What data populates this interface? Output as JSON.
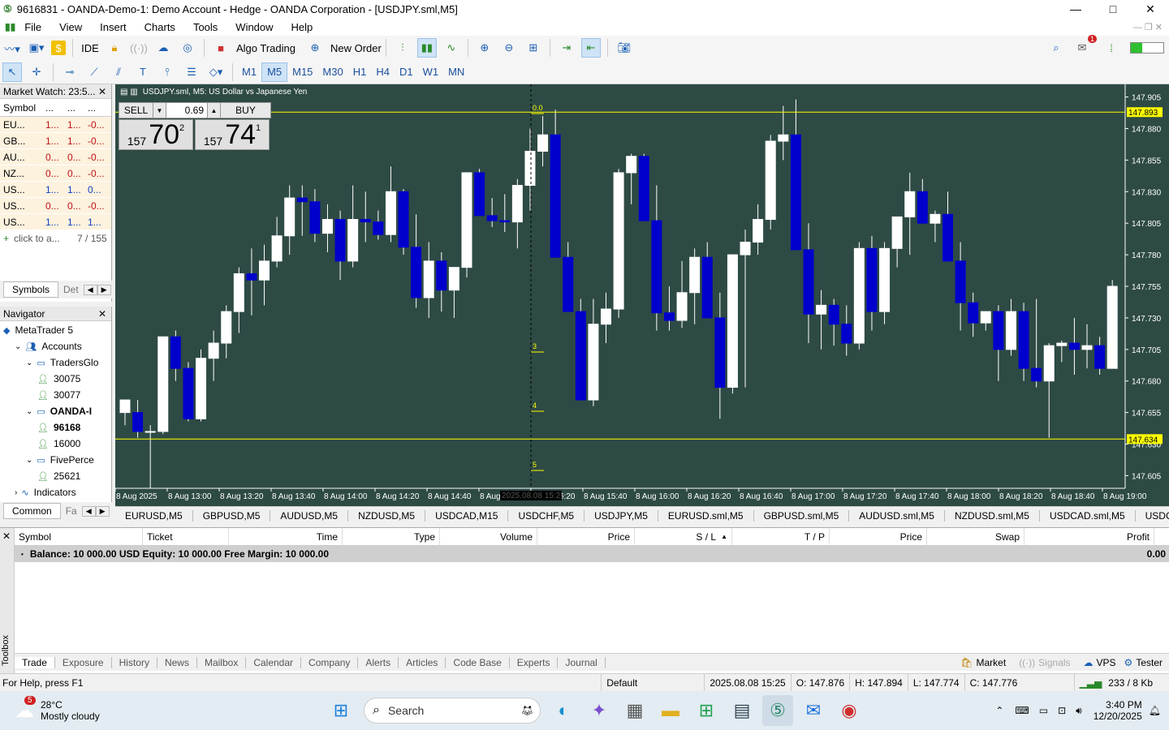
{
  "window": {
    "title": "9616831 - OANDA-Demo-1: Demo Account - Hedge - OANDA Corporation - [USDJPY.sml,M5]",
    "minimize": "—",
    "maximize": "□",
    "close": "✕"
  },
  "menu": [
    "File",
    "View",
    "Insert",
    "Charts",
    "Tools",
    "Window",
    "Help"
  ],
  "toolbar": {
    "ide": "IDE",
    "algo_trading": "Algo Trading",
    "new_order": "New Order",
    "notifications_badge": "1"
  },
  "timeframes": [
    "M1",
    "M5",
    "M15",
    "M30",
    "H1",
    "H4",
    "D1",
    "W1",
    "MN"
  ],
  "active_timeframe": "M5",
  "market_watch": {
    "title": "Market Watch: 23:5...",
    "columns": [
      "Symbol",
      "...",
      "...",
      "..."
    ],
    "rows": [
      {
        "symbol": "EU...",
        "bid": "1...",
        "ask": "1...",
        "chg": "-0...",
        "neg": true
      },
      {
        "symbol": "GB...",
        "bid": "1...",
        "ask": "1...",
        "chg": "-0...",
        "neg": true
      },
      {
        "symbol": "AU...",
        "bid": "0...",
        "ask": "0...",
        "chg": "-0...",
        "neg": true
      },
      {
        "symbol": "NZ...",
        "bid": "0...",
        "ask": "0...",
        "chg": "-0...",
        "neg": true
      },
      {
        "symbol": "US...",
        "bid": "1...",
        "ask": "1...",
        "chg": "0...",
        "neg": false
      },
      {
        "symbol": "US...",
        "bid": "0...",
        "ask": "0...",
        "chg": "-0...",
        "neg": true
      },
      {
        "symbol": "US...",
        "bid": "1...",
        "ask": "1...",
        "chg": "1...",
        "neg": false
      }
    ],
    "add_row": "click to a...",
    "count": "7 / 155",
    "tabs": [
      "Symbols",
      "Det"
    ]
  },
  "navigator": {
    "title": "Navigator",
    "items": [
      {
        "label": "MetaTrader 5",
        "level": 0,
        "bold": false
      },
      {
        "label": "Accounts",
        "level": 1,
        "bold": false
      },
      {
        "label": "TradersGlo",
        "level": 2,
        "bold": false
      },
      {
        "label": "30075",
        "level": 3,
        "bold": false
      },
      {
        "label": "30077",
        "level": 3,
        "bold": false
      },
      {
        "label": "OANDA-I",
        "level": 2,
        "bold": true
      },
      {
        "label": "96168",
        "level": 3,
        "bold": true
      },
      {
        "label": "16000",
        "level": 3,
        "bold": false
      },
      {
        "label": "FivePerce",
        "level": 2,
        "bold": false
      },
      {
        "label": "25621",
        "level": 3,
        "bold": false
      },
      {
        "label": "Indicators",
        "level": 1,
        "bold": false
      }
    ],
    "tabs": [
      "Common",
      "Fa"
    ]
  },
  "chart": {
    "header": "USDJPY.sml, M5:  US Dollar vs Japanese Yen",
    "sell_label": "SELL",
    "buy_label": "BUY",
    "volume": "0.69",
    "sell_price_small": "157",
    "sell_price_big": "70",
    "sell_price_sup": "2",
    "buy_price_small": "157",
    "buy_price_big": "74",
    "buy_price_sup": "1",
    "upper_line_label": "147.893",
    "lower_line_label": "147.634",
    "fib_labels": [
      "0.0",
      "3",
      "4",
      "5"
    ],
    "crosshair_time": "2025.08.08 15:25",
    "colors": {
      "background": "#2e4a45",
      "bull": "#ffffff",
      "bear": "#0000cc",
      "line": "#ffff00"
    }
  },
  "chart_data": {
    "type": "candlestick",
    "symbol": "USDJPY.sml",
    "timeframe": "M5",
    "y_ticks": [
      "147.905",
      "147.880",
      "147.855",
      "147.830",
      "147.805",
      "147.780",
      "147.755",
      "147.730",
      "147.705",
      "147.680",
      "147.655",
      "147.630",
      "147.605"
    ],
    "x_ticks": [
      "8 Aug 2025",
      "8 Aug 13:00",
      "8 Aug 13:20",
      "8 Aug 13:40",
      "8 Aug 14:00",
      "8 Aug 14:20",
      "8 Aug 14:40",
      "8 Aug 15:00",
      "8 Aug 15:20",
      "8 Aug 15:40",
      "8 Aug 16:00",
      "8 Aug 16:20",
      "8 Aug 16:40",
      "8 Aug 17:00",
      "8 Aug 17:20",
      "8 Aug 17:40",
      "8 Aug 18:00",
      "8 Aug 18:20",
      "8 Aug 18:40",
      "8 Aug 19:00"
    ],
    "ylim": [
      147.595,
      147.915
    ],
    "ohlc": [
      [
        147.655,
        147.665,
        147.645,
        147.665
      ],
      [
        147.655,
        147.665,
        147.635,
        147.64
      ],
      [
        147.64,
        147.645,
        147.595,
        147.64
      ],
      [
        147.64,
        147.715,
        147.638,
        147.715
      ],
      [
        147.715,
        147.72,
        147.68,
        147.69
      ],
      [
        147.69,
        147.695,
        147.648,
        147.65
      ],
      [
        147.65,
        147.705,
        147.648,
        147.698
      ],
      [
        147.698,
        147.72,
        147.68,
        147.71
      ],
      [
        147.71,
        147.74,
        147.698,
        147.735
      ],
      [
        147.735,
        147.77,
        147.718,
        147.765
      ],
      [
        147.765,
        147.785,
        147.732,
        147.76
      ],
      [
        147.76,
        147.788,
        147.74,
        147.775
      ],
      [
        147.775,
        147.81,
        147.77,
        147.795
      ],
      [
        147.795,
        147.835,
        147.78,
        147.825
      ],
      [
        147.825,
        147.835,
        147.795,
        147.822
      ],
      [
        147.822,
        147.832,
        147.79,
        147.797
      ],
      [
        147.797,
        147.82,
        147.782,
        147.808
      ],
      [
        147.808,
        147.815,
        147.76,
        147.775
      ],
      [
        147.775,
        147.835,
        147.77,
        147.808
      ],
      [
        147.808,
        147.83,
        147.79,
        147.806
      ],
      [
        147.806,
        147.815,
        147.792,
        147.796
      ],
      [
        147.796,
        147.85,
        147.79,
        147.83
      ],
      [
        147.83,
        147.832,
        147.78,
        147.786
      ],
      [
        147.786,
        147.812,
        147.738,
        147.746
      ],
      [
        147.746,
        147.79,
        147.73,
        147.775
      ],
      [
        147.775,
        147.782,
        147.735,
        147.752
      ],
      [
        147.752,
        147.768,
        147.73,
        147.77
      ],
      [
        147.77,
        147.845,
        147.762,
        147.845
      ],
      [
        147.845,
        147.848,
        147.815,
        147.811
      ],
      [
        147.811,
        147.825,
        147.802,
        147.807
      ],
      [
        147.807,
        147.828,
        147.798,
        147.806
      ],
      [
        147.806,
        147.84,
        147.785,
        147.835
      ],
      [
        147.835,
        147.88,
        147.815,
        147.862
      ],
      [
        147.862,
        147.89,
        147.85,
        147.875
      ],
      [
        147.875,
        147.895,
        147.8,
        147.778
      ],
      [
        147.778,
        147.79,
        147.745,
        147.735
      ],
      [
        147.735,
        147.745,
        147.67,
        147.665
      ],
      [
        147.665,
        147.745,
        147.66,
        147.725
      ],
      [
        147.725,
        147.75,
        147.71,
        147.737
      ],
      [
        147.737,
        147.848,
        147.73,
        147.845
      ],
      [
        147.845,
        147.86,
        147.82,
        147.858
      ],
      [
        147.858,
        147.86,
        147.81,
        147.807
      ],
      [
        147.807,
        147.835,
        147.72,
        147.734
      ],
      [
        147.734,
        147.755,
        147.72,
        147.728
      ],
      [
        147.728,
        147.775,
        147.722,
        147.75
      ],
      [
        147.75,
        147.785,
        147.725,
        147.778
      ],
      [
        147.778,
        147.79,
        147.74,
        147.73
      ],
      [
        147.73,
        147.75,
        147.65,
        147.675
      ],
      [
        147.675,
        147.78,
        147.67,
        147.78
      ],
      [
        147.78,
        147.8,
        147.675,
        147.79
      ],
      [
        147.79,
        147.82,
        147.78,
        147.808
      ],
      [
        147.808,
        147.875,
        147.8,
        147.87
      ],
      [
        147.87,
        147.898,
        147.855,
        147.875
      ],
      [
        147.875,
        147.903,
        147.79,
        147.784
      ],
      [
        147.784,
        147.805,
        147.71,
        147.733
      ],
      [
        147.733,
        147.752,
        147.705,
        147.74
      ],
      [
        147.74,
        147.745,
        147.708,
        147.725
      ],
      [
        147.725,
        147.74,
        147.7,
        147.71
      ],
      [
        147.71,
        147.79,
        147.705,
        147.785
      ],
      [
        147.785,
        147.795,
        147.72,
        147.735
      ],
      [
        147.735,
        147.79,
        147.725,
        147.785
      ],
      [
        147.785,
        147.81,
        147.77,
        147.81
      ],
      [
        147.81,
        147.845,
        147.78,
        147.83
      ],
      [
        147.83,
        147.84,
        147.805,
        147.805
      ],
      [
        147.805,
        147.815,
        147.79,
        147.812
      ],
      [
        147.812,
        147.83,
        147.775,
        147.775
      ],
      [
        147.775,
        147.79,
        147.72,
        147.742
      ],
      [
        147.742,
        147.75,
        147.715,
        147.726
      ],
      [
        147.726,
        147.73,
        147.72,
        147.735
      ],
      [
        147.735,
        147.74,
        147.68,
        147.705
      ],
      [
        147.705,
        147.745,
        147.7,
        147.735
      ],
      [
        147.735,
        147.742,
        147.68,
        147.69
      ],
      [
        147.69,
        147.745,
        147.675,
        147.68
      ],
      [
        147.68,
        147.71,
        147.635,
        147.708
      ],
      [
        147.708,
        147.712,
        147.695,
        147.71
      ],
      [
        147.71,
        147.73,
        147.685,
        147.705
      ],
      [
        147.705,
        147.725,
        147.69,
        147.708
      ],
      [
        147.708,
        147.715,
        147.685,
        147.69
      ],
      [
        147.69,
        147.76,
        147.69,
        147.755
      ]
    ]
  },
  "chart_tabs": [
    "EURUSD,M5",
    "GBPUSD,M5",
    "AUDUSD,M5",
    "NZDUSD,M5",
    "USDCAD,M15",
    "USDCHF,M5",
    "USDJPY,M5",
    "EURUSD.sml,M5",
    "GBPUSD.sml,M5",
    "AUDUSD.sml,M5",
    "NZDUSD.sml,M5",
    "USDCAD.sml,M5",
    "USDCHF.sml,M5",
    "US"
  ],
  "trade_table": {
    "columns": [
      "Symbol",
      "Ticket",
      "Time",
      "Type",
      "Volume",
      "Price",
      "S / L",
      "T / P",
      "Price",
      "Swap",
      "Profit"
    ],
    "balance_text": "Balance: 10 000.00 USD  Equity: 10 000.00  Free Margin: 10 000.00",
    "profit": "0.00"
  },
  "toolbox_label": "Toolbox",
  "toolbox_tabs": [
    "Trade",
    "Exposure",
    "History",
    "News",
    "Mailbox",
    "Calendar",
    "Company",
    "Alerts",
    "Articles",
    "Code Base",
    "Experts",
    "Journal"
  ],
  "toolbox_right": [
    "Market",
    "Signals",
    "VPS",
    "Tester"
  ],
  "status": {
    "help": "For Help, press F1",
    "profile": "Default",
    "time": "2025.08.08 15:25",
    "open": "O: 147.876",
    "high": "H: 147.894",
    "low": "L: 147.774",
    "close": "C: 147.776",
    "traffic": "233 / 8 Kb"
  },
  "taskbar": {
    "weather_temp": "28°C",
    "weather_desc": "Mostly cloudy",
    "weather_badge": "5",
    "search": "Search",
    "clock_time": "3:40 PM",
    "clock_date": "12/20/2025"
  }
}
